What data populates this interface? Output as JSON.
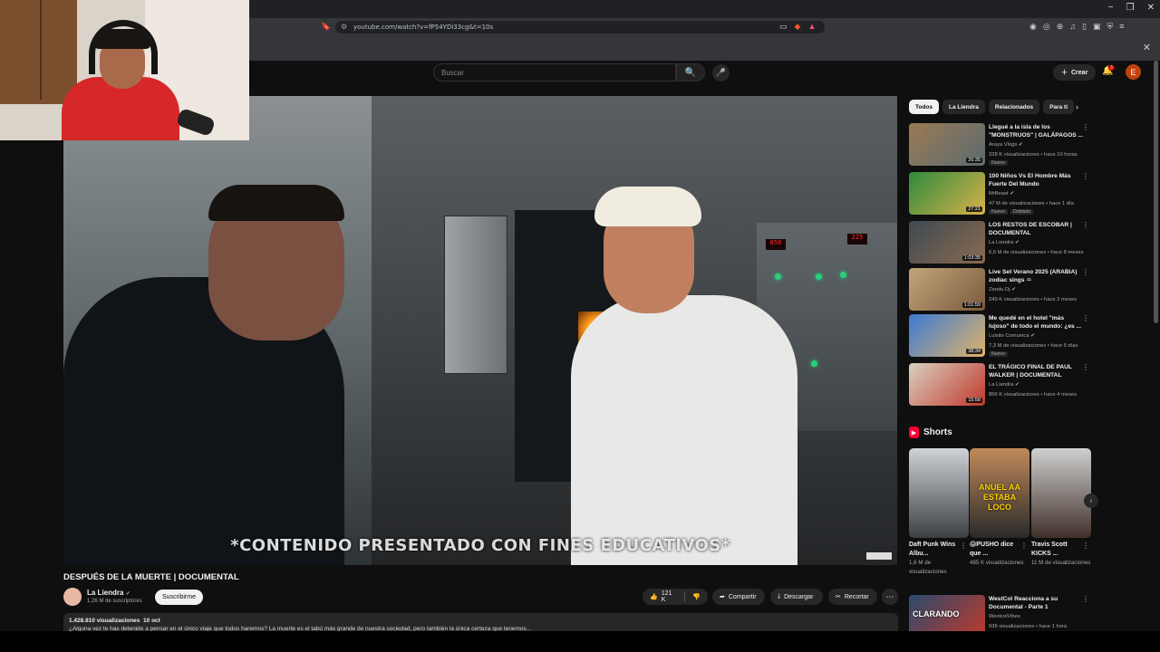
{
  "browser": {
    "url": "youtube.com/watch?v=fP54YDi33cg&t=10s",
    "window_controls": [
      "−",
      "❐",
      "✕"
    ],
    "bookmarks_close": "✕"
  },
  "header": {
    "search_placeholder": "Buscar",
    "create_label": "Crear",
    "notifications_count": "3",
    "avatar_letter": "E"
  },
  "player": {
    "subtitle": "*CONTENIDO PRESENTADO CON FINES EDUCATIVOS*",
    "panel_display_1": "850",
    "panel_display_2": "225"
  },
  "video": {
    "title": "DESPUÉS DE LA MUERTE | DOCUMENTAL",
    "channel": "La Liendra",
    "subscribers": "1,26 M de suscriptores",
    "subscribe_label": "Suscribirme",
    "likes": "121 K",
    "share_label": "Compartir",
    "download_label": "Descargar",
    "clip_label": "Recortar",
    "more_label": "⋯",
    "views": "1.428.810 visualizaciones",
    "date": "10 oct",
    "description": "¿Alguna vez te has detenido a pensar en el único viaje que todos haremos? La muerte es el tabú más grande de nuestra sociedad, pero también la única certeza que tenemos..."
  },
  "sidebar": {
    "chips": [
      "Todos",
      "La Liendra",
      "Relacionados",
      "Para ti"
    ],
    "recommendations": [
      {
        "title": "Llegué a la isla de los \"MONSTRUOS\" | GALÁPAGOS ...",
        "channel": "Araya Vlogs",
        "meta": "328 K visualizaciones • hace 10 horas",
        "badge": "Nuevo",
        "badge2": "",
        "duration": "26:35",
        "color1": "#9a7a55",
        "color2": "#5c6b70"
      },
      {
        "title": "100 Niños Vs El Hombre Más Fuerte Del Mundo",
        "channel": "MrBeast",
        "meta": "47 M de visualizaciones • hace 1 día",
        "badge": "Nuevo",
        "badge2": "Doblado",
        "duration": "27:21",
        "color1": "#2f8a3d",
        "color2": "#d9b14a"
      },
      {
        "title": "LOS RESTOS DE ESCOBAR | DOCUMENTAL",
        "channel": "La Liendra",
        "meta": "6,6 M de visualizaciones • hace 8 meses",
        "badge": "",
        "badge2": "",
        "duration": "1:03:35",
        "color1": "#3d4a52",
        "color2": "#8b6a4f"
      },
      {
        "title": "Live Set Verano 2025 (ARABIA) zodiac sings ♒",
        "channel": "Zandu Dj",
        "meta": "249 K visualizaciones • hace 2 meses",
        "badge": "",
        "badge2": "",
        "duration": "1:01:59",
        "color1": "#c2a57a",
        "color2": "#7c5a3e"
      },
      {
        "title": "Me quedé en el hotel \"más lujoso\" de todo el mundo: ¿es ...",
        "channel": "Luisito Comunica",
        "meta": "7,3 M de visualizaciones • hace 5 días",
        "badge": "Nuevo",
        "badge2": "",
        "duration": "38:34",
        "color1": "#3b7bd1",
        "color2": "#e0b36a"
      },
      {
        "title": "EL TRÁGICO FINAL DE PAUL WALKER | DOCUMENTAL",
        "channel": "La Liendra",
        "meta": "856 K visualizaciones • hace 4 meses",
        "badge": "",
        "badge2": "",
        "duration": "15:58",
        "color1": "#d9d0c0",
        "color2": "#c0392b"
      }
    ],
    "shorts_title": "Shorts",
    "shorts": [
      {
        "title": "Daft Punk Wins Albu...",
        "views": "1,6 M de visualizaciones",
        "color1": "#cfd2d6",
        "color2": "#3c3f44"
      },
      {
        "title": "😱PUSHO dice que ...",
        "views": "485 K visualizaciones",
        "color1": "#c08a5a",
        "color2": "#2a2a2a"
      },
      {
        "title": "Travis Scott KICKS ...",
        "views": "11 M de visualizaciones",
        "color1": "#d0d0d0",
        "color2": "#40302a"
      }
    ],
    "short_overlay_text": "ANUEL AA ESTABA LOCO",
    "last_rec": {
      "title": "WestCol Reacciona a su Documental - Parte 1",
      "channel": "WestcolVibes",
      "meta": "936 visualizaciones • hace 1 hora",
      "thumb_text": "CLARANDO",
      "color1": "#2b4a6e",
      "color2": "#c0392b"
    }
  },
  "colors": {
    "accent": "#ff0033",
    "background": "#0f0f0f"
  }
}
